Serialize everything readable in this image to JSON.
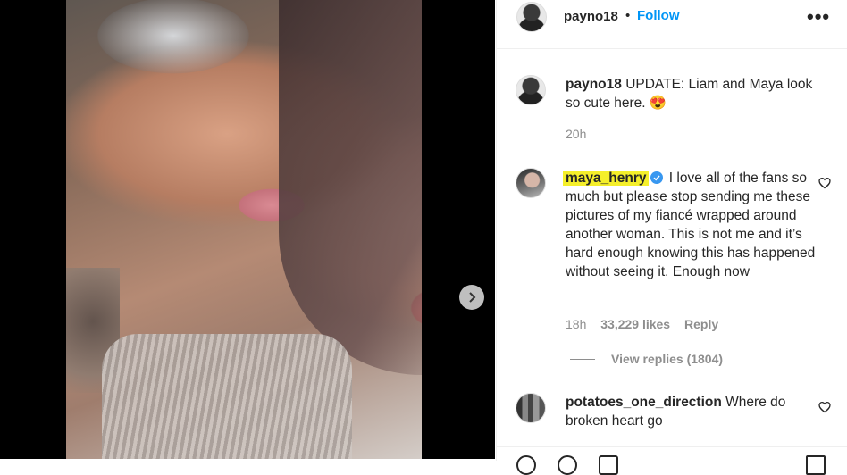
{
  "post": {
    "author": "payno18",
    "separator": "•",
    "follow_label": "Follow",
    "more_label": "•••"
  },
  "caption": {
    "username": "payno18",
    "text": "UPDATE: Liam and Maya look so cute here. 😍",
    "time": "20h"
  },
  "comments": [
    {
      "username": "maya_henry",
      "verified": true,
      "text": "I love all of the fans so much but please stop sending me these pictures of my fiancé wrapped around another woman. This is not me and it’s hard enough knowing this has happened without seeing it. Enough now",
      "time": "18h",
      "likes": "33,229 likes",
      "reply_label": "Reply",
      "view_replies": "View replies (1804)"
    },
    {
      "username": "potatoes_one_direction",
      "text": "Where do broken heart go"
    }
  ],
  "colors": {
    "accent": "#0095f6",
    "highlight": "#f5ef2a",
    "verified": "#3897f0"
  }
}
